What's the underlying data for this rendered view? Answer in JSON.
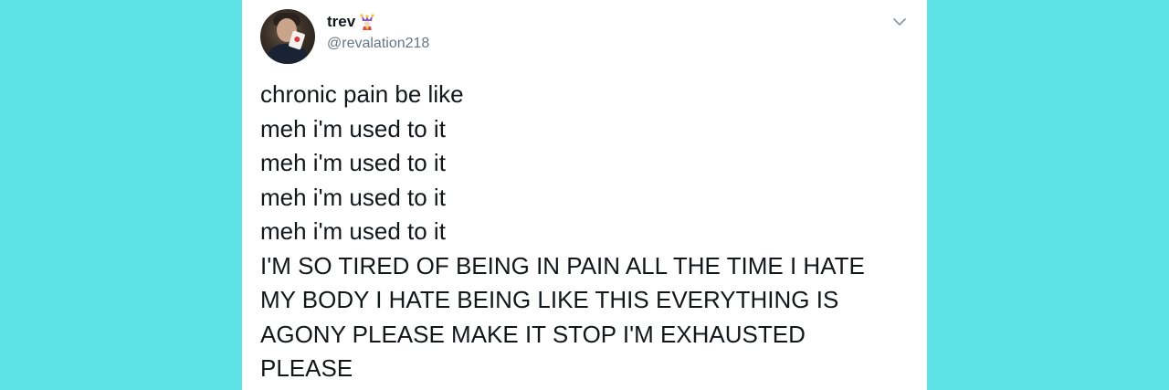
{
  "tweet": {
    "author": {
      "display_name": "trev",
      "handle": "@revalation218",
      "name_emoji_icon": "jester-icon",
      "avatar_icon": "avatar-photo"
    },
    "menu_icon": "chevron-down-icon",
    "lines": [
      "chronic pain be like",
      "meh i'm used to it",
      "meh i'm used to it",
      "meh i'm used to it",
      "meh i'm used to it"
    ],
    "final_paragraph": "I'M SO TIRED OF BEING IN PAIN ALL THE TIME I HATE MY BODY I HATE BEING LIKE THIS EVERYTHING IS AGONY PLEASE MAKE IT STOP I'M EXHAUSTED PLEASE"
  },
  "colors": {
    "background": "#5de0e6",
    "card": "#ffffff",
    "text": "#14171a",
    "handle": "#657786",
    "chevron": "#8899a6"
  }
}
